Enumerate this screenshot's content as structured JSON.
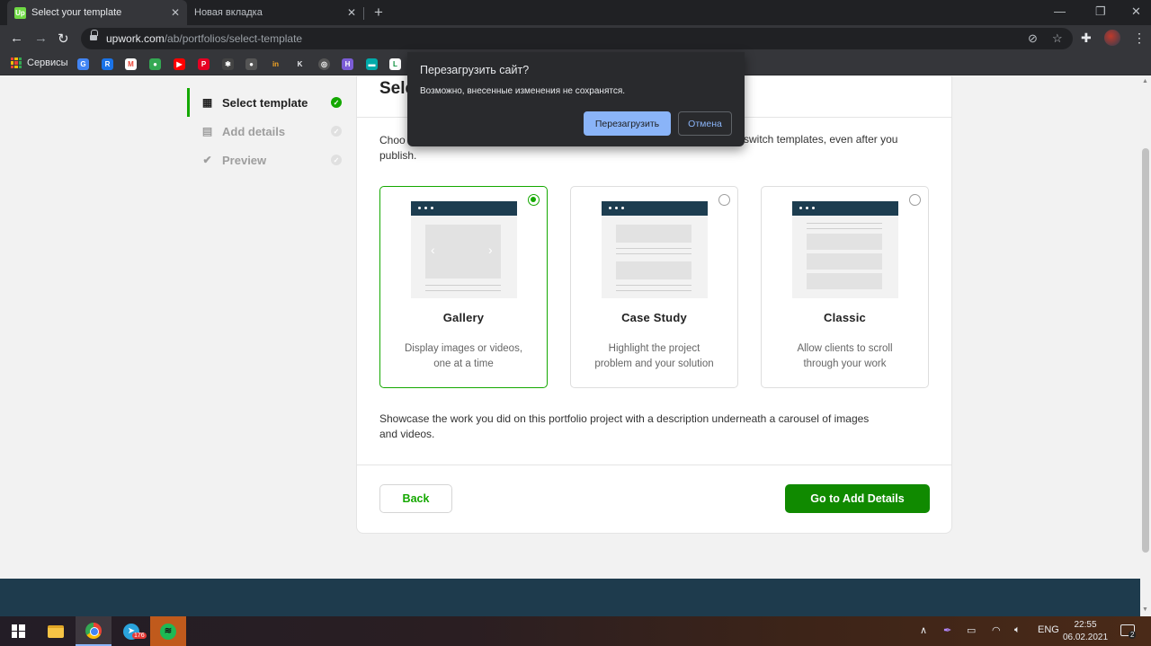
{
  "browser": {
    "tabs": [
      {
        "title": "Select your template",
        "favicon": "Up"
      },
      {
        "title": "Новая вкладка"
      }
    ],
    "url_domain": "upwork.com",
    "url_path": "/ab/portfolios/select-template",
    "bookmarks_label": "Сервисы"
  },
  "dialog": {
    "title": "Перезагрузить сайт?",
    "message": "Возможно, внесенные изменения не сохранятся.",
    "reload_label": "Перезагрузить",
    "cancel_label": "Отмена"
  },
  "steps": [
    {
      "label": "Select template",
      "state": "active"
    },
    {
      "label": "Add details",
      "state": "pending"
    },
    {
      "label": "Preview",
      "state": "pending"
    }
  ],
  "main": {
    "heading_visible": "Sele",
    "intro_visible_start": "Choo",
    "intro_visible_tail": "switch templates, even after you",
    "intro_line2": "publish.",
    "templates": [
      {
        "name": "Gallery",
        "desc_line1": "Display images or videos,",
        "desc_line2": "one at a time",
        "selected": true
      },
      {
        "name": "Case Study",
        "desc_line1": "Highlight the project",
        "desc_line2": "problem and your solution",
        "selected": false
      },
      {
        "name": "Classic",
        "desc_line1": "Allow clients to scroll",
        "desc_line2": "through your work",
        "selected": false
      }
    ],
    "selected_description_line1": "Showcase the work you did on this portfolio project with a description underneath a carousel of images",
    "selected_description_line2": "and videos.",
    "back_label": "Back",
    "next_label": "Go to Add Details"
  },
  "taskbar": {
    "telegram_badge": "176",
    "language": "ENG",
    "time": "22:55",
    "date": "06.02.2021",
    "notification_count": "2"
  },
  "colors": {
    "brand_green": "#14a800",
    "button_green": "#108a00",
    "header_navy": "#1d3d50",
    "dialog_blue": "#8ab4f8"
  }
}
